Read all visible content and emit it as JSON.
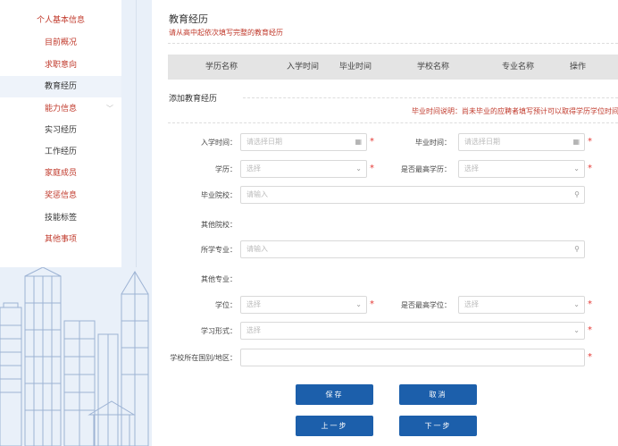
{
  "sidebar": {
    "items": [
      {
        "label": "个人基本信息"
      },
      {
        "label": "目前概况"
      },
      {
        "label": "求职意向"
      },
      {
        "label": "教育经历"
      },
      {
        "label": "能力信息"
      },
      {
        "label": "实习经历"
      },
      {
        "label": "工作经历"
      },
      {
        "label": "家庭成员"
      },
      {
        "label": "奖惩信息"
      },
      {
        "label": "技能标签"
      },
      {
        "label": "其他事项"
      }
    ]
  },
  "main": {
    "title": "教育经历",
    "subtitle": "请从高中起依次填写完整的教育经历",
    "table": {
      "columns": [
        "学历名称",
        "入学时间",
        "毕业时间",
        "学校名称",
        "专业名称",
        "操作"
      ]
    },
    "section_title": "添加教育经历",
    "note": "毕业时间说明：尚未毕业的应聘者填写预计可以取得学历学位时间",
    "form": {
      "enroll_label": "入学时间：",
      "enroll_placeholder": "请选择日期",
      "grad_label": "毕业时间：",
      "grad_placeholder": "请选择日期",
      "degree_label": "学历：",
      "degree_value": "选择",
      "highest_degree_label": "是否最高学历：",
      "highest_degree_value": "选择",
      "school_label": "毕业院校：",
      "school_placeholder": "请输入",
      "other_school_label": "其他院校：",
      "major_label": "所学专业：",
      "major_placeholder": "请输入",
      "other_major_label": "其他专业：",
      "degree2_label": "学位：",
      "degree2_value": "选择",
      "highest_degree2_label": "是否最高学位：",
      "highest_degree2_value": "选择",
      "study_form_label": "学习形式：",
      "study_form_value": "选择",
      "location_label": "学校所在国别/地区：",
      "location_value": "",
      "required_mark": "*"
    },
    "buttons": {
      "save": "保存",
      "cancel": "取消",
      "prev": "上一步",
      "next": "下一步"
    }
  },
  "colors": {
    "accent_red": "#c0392b",
    "button_blue": "#1c5fab",
    "page_bg": "#e9f0f9"
  }
}
